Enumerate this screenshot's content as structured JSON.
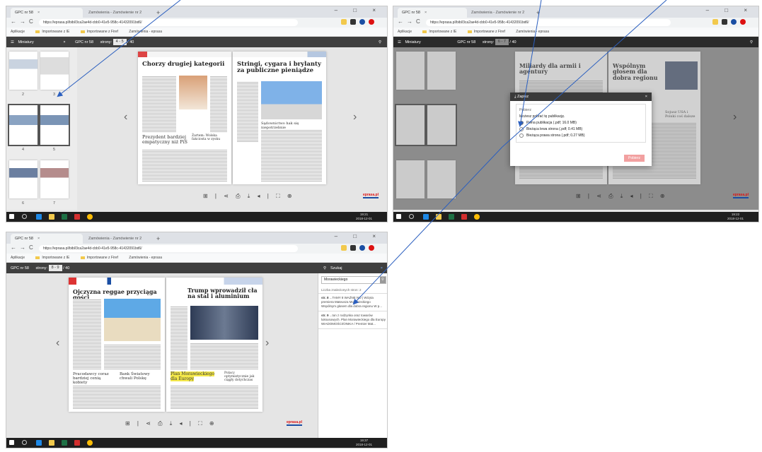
{
  "browser": {
    "tab_active": "GPC nr 58",
    "tab_inactive": "Zamówienia - Zamówienie nr 2",
    "tab_close": "×",
    "newtab": "+",
    "url": "https://eprasa.pl/bibl/3ca2ae4d-cbb0-41e5-958c-41432091bd6/",
    "bookmarks": [
      "Aplikacje",
      "Importowane z IE",
      "Importowane z Firef",
      "Zamówienia - eprasa"
    ],
    "win_controls": "–  □  ×"
  },
  "shot1": {
    "panel_label": "Miniatury",
    "panel_close": "×",
    "issue": "GPC nr 58",
    "pages_label": "strony:",
    "pages_value": "4 - 5",
    "pages_total": "/ 40",
    "thumb_numbers": [
      "2",
      "3",
      "4",
      "5",
      "6",
      "7"
    ],
    "left_headline": "Chorzy drugiej kategorii",
    "left_sub": "Prezydent bardziej empatyczny niż PiS",
    "left_sub2": "Żartem: Wolska fakciosta w zysku",
    "right_headline": "Stringi, cygara i brylanty za publiczne pieniądze",
    "right_sub": "Sądownictwo hak się niepotrzebnie",
    "logo": "eprasa.pl",
    "clock_time": "19:21",
    "clock_date": "2018-12-01"
  },
  "shot2": {
    "panel_label": "Miniatury",
    "issue": "GPC nr 58",
    "pages_label": "strony:",
    "pages_value": "6 - 7",
    "pages_total": "/ 40",
    "left_headline": "Miliardy dla armii i agentury",
    "right_headline": "Wspólnym głosem dla dobra regionu",
    "right_sub": "Sojusz USA i Polski coś dalsze",
    "modal_title": "Zapisz",
    "modal_close": "×",
    "modal_section": "Pobierz",
    "modal_text": "Możesz pobrać tę publikację.",
    "options": [
      "Pełna publikacja (.pdf; 16.0 MB)",
      "Bieżąca lewa strona (.pdf; 0.41 MB)",
      "Bieżąca prawa strona (.pdf; 0.27 MB)"
    ],
    "download_button": "Pobierz",
    "logo": "eprasa.pl",
    "clock_time": "19:22",
    "clock_date": "2018-12-01"
  },
  "shot3": {
    "issue": "GPC nr 58",
    "pages_label": "strony:",
    "pages_value": "8 - 9",
    "pages_total": "/ 40",
    "search_label": "Szukaj",
    "search_close": "×",
    "search_value": "Morawieckiego",
    "results_label": "Liczba znalezionych stron: 2",
    "hits": [
      {
        "page": "str. 8",
        "text": "...TAMY 8 WAŻNE NO | Wizyta premiera Mateusza Morawieckiego Wspólnym głosem dla dobra regionu W p..."
      },
      {
        "page": "str. 9",
        "text": "...ton z rodzynka oraz towarów luksusowych. Plan Morawieckiego dla Europy WIADOMOŚCI/ONIKA / Premier Mat..."
      }
    ],
    "left_headline": "Ojczyzna reggae przyciąga gości",
    "left_sub1": "Pracodawcy coraz bardziej cenią kobiety",
    "left_sub2": "Bank Światowy chwali Polskę",
    "right_headline": "Trump wprowadził cła na stal i aluminium",
    "right_sub1": "Plan Morawieckiego dla Europy",
    "right_sub2": "Polacy optymistycznie jak ciągły dotychczas",
    "logo": "eprasa.pl",
    "clock_time": "19:37",
    "clock_date": "2018-12-01"
  },
  "colors": {
    "toolbar": "#3f3f3f",
    "accent_blue": "#1a4ea3",
    "annotation": "#2b5fbf",
    "highlight": "#f5e94a"
  }
}
